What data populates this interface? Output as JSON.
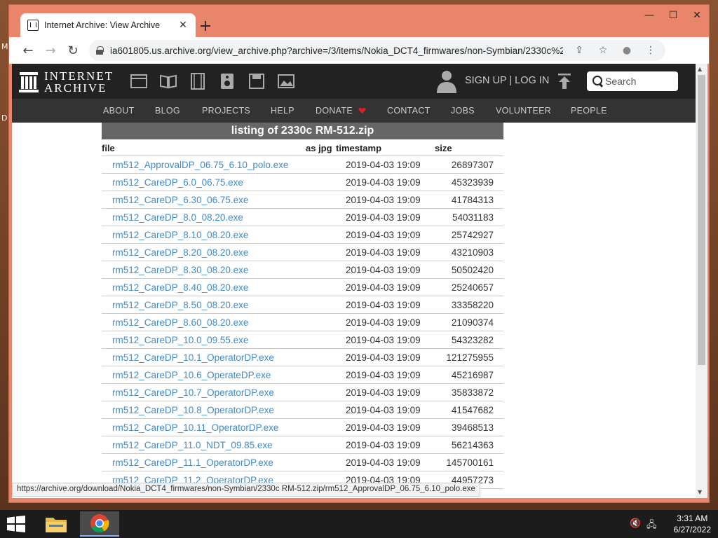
{
  "desktop": {
    "marks": [
      "M",
      "D"
    ]
  },
  "window": {
    "controls": {
      "minimize": "—",
      "maximize": "☐",
      "close": "✕"
    }
  },
  "tab": {
    "title": "Internet Archive: View Archive",
    "close": "✕",
    "new_tab": "+"
  },
  "toolbar": {
    "back": "←",
    "forward": "→",
    "reload": "↻",
    "url": "ia601805.us.archive.org/view_archive.php?archive=/3/items/Nokia_DCT4_firmwares/non-Symbian/2330c%20RM...",
    "share": "⇪",
    "bookmark": "☆",
    "profile": "●",
    "menu": "⋮"
  },
  "ia": {
    "logo_line1": "INTERNET",
    "logo_line2": "ARCHIVE",
    "signup": "SIGN UP | LOG IN",
    "search_placeholder": "Search",
    "nav": [
      "ABOUT",
      "BLOG",
      "PROJECTS",
      "HELP",
      "DONATE",
      "CONTACT",
      "JOBS",
      "VOLUNTEER",
      "PEOPLE"
    ],
    "donate_heart_color": "#e02020"
  },
  "listing": {
    "title": "listing of 2330c RM-512.zip",
    "headers": {
      "file": "file",
      "as_jpg": "as jpg",
      "timestamp": "timestamp",
      "size": "size"
    },
    "rows": [
      {
        "file": "rm512_ApprovalDP_06.75_6.10_polo.exe",
        "timestamp": "2019-04-03 19:09",
        "size": "26897307"
      },
      {
        "file": "rm512_CareDP_6.0_06.75.exe",
        "timestamp": "2019-04-03 19:09",
        "size": "45323939"
      },
      {
        "file": "rm512_CareDP_6.30_06.75.exe",
        "timestamp": "2019-04-03 19:09",
        "size": "41784313"
      },
      {
        "file": "rm512_CareDP_8.0_08.20.exe",
        "timestamp": "2019-04-03 19:09",
        "size": "54031183"
      },
      {
        "file": "rm512_CareDP_8.10_08.20.exe",
        "timestamp": "2019-04-03 19:09",
        "size": "25742927"
      },
      {
        "file": "rm512_CareDP_8.20_08.20.exe",
        "timestamp": "2019-04-03 19:09",
        "size": "43210903"
      },
      {
        "file": "rm512_CareDP_8.30_08.20.exe",
        "timestamp": "2019-04-03 19:09",
        "size": "50502420"
      },
      {
        "file": "rm512_CareDP_8.40_08.20.exe",
        "timestamp": "2019-04-03 19:09",
        "size": "25240657"
      },
      {
        "file": "rm512_CareDP_8.50_08.20.exe",
        "timestamp": "2019-04-03 19:09",
        "size": "33358220"
      },
      {
        "file": "rm512_CareDP_8.60_08.20.exe",
        "timestamp": "2019-04-03 19:09",
        "size": "21090374"
      },
      {
        "file": "rm512_CareDP_10.0_09.55.exe",
        "timestamp": "2019-04-03 19:09",
        "size": "54323282"
      },
      {
        "file": "rm512_CareDP_10.1_OperatorDP.exe",
        "timestamp": "2019-04-03 19:09",
        "size": "121275955"
      },
      {
        "file": "rm512_CareDP_10.6_OperateDP.exe",
        "timestamp": "2019-04-03 19:09",
        "size": "45216987"
      },
      {
        "file": "rm512_CareDP_10.7_OperatorDP.exe",
        "timestamp": "2019-04-03 19:09",
        "size": "35833872"
      },
      {
        "file": "rm512_CareDP_10.8_OperatorDP.exe",
        "timestamp": "2019-04-03 19:09",
        "size": "41547682"
      },
      {
        "file": "rm512_CareDP_10.11_OperatorDP.exe",
        "timestamp": "2019-04-03 19:09",
        "size": "39468513"
      },
      {
        "file": "rm512_CareDP_11.0_NDT_09.85.exe",
        "timestamp": "2019-04-03 19:09",
        "size": "56214363"
      },
      {
        "file": "rm512_CareDP_11.1_OperatorDP.exe",
        "timestamp": "2019-04-03 19:09",
        "size": "145700161"
      },
      {
        "file": "rm512_CareDP_11.2_OperatorDP.exe",
        "timestamp": "2019-04-03 19:09",
        "size": "44957273"
      }
    ]
  },
  "status_bar": "https://archive.org/download/Nokia_DCT4_firmwares/non-Symbian/2330c RM-512.zip/rm512_ApprovalDP_06.75_6.10_polo.exe",
  "scrollbar": {
    "up": "▲",
    "down": "▼"
  },
  "taskbar": {
    "clock_time": "3:31 AM",
    "clock_date": "6/27/2022",
    "volume": "🔇",
    "network": "🖧"
  },
  "colors": {
    "link": "#428bca",
    "ia_dark": "#222222",
    "ia_nav": "#333333",
    "listing_title_bg": "#666666"
  }
}
